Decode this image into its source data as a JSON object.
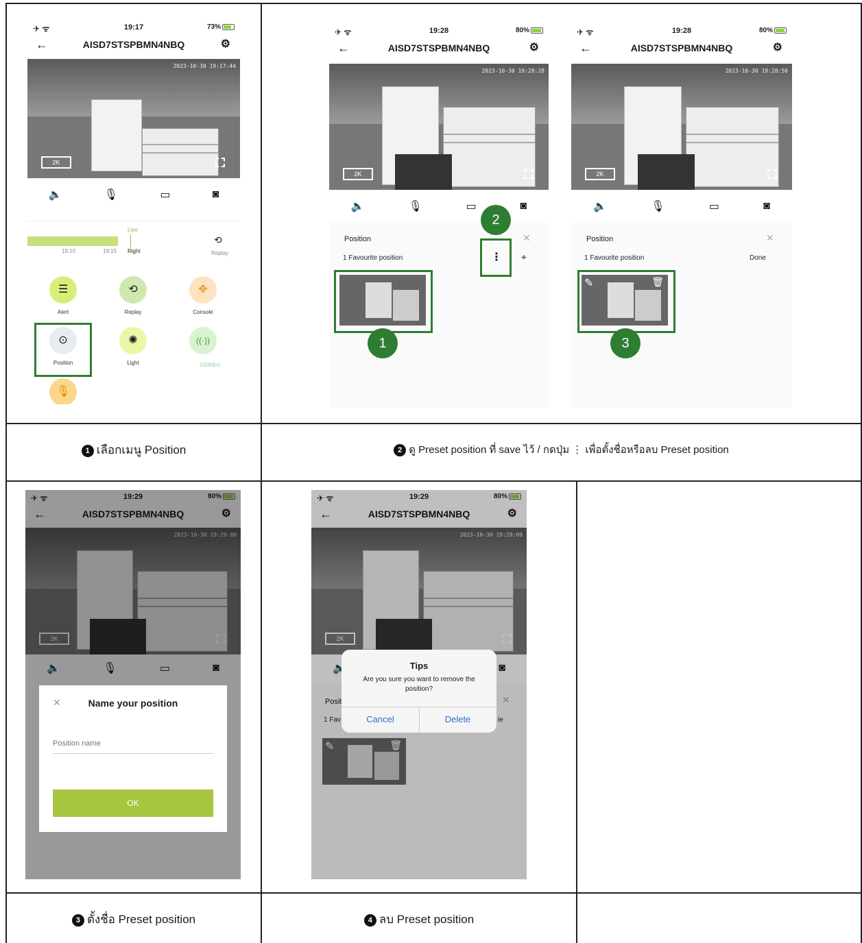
{
  "phone": {
    "device_name": "AISD7STSPBMN4NBQ",
    "quality": "2K"
  },
  "screen1": {
    "time": "19:17",
    "battery": "73%",
    "timestamp": "2023-10-30 19:17:44",
    "timeline": {
      "live": "Live",
      "t1": "19:10",
      "t2": "19:15",
      "right": "Right",
      "replay": "Replay"
    },
    "features": [
      {
        "label": "Alert"
      },
      {
        "label": "Replay"
      },
      {
        "label": "Console"
      },
      {
        "label": "Position"
      },
      {
        "label": "Light"
      },
      {
        "label": "100KB/s"
      }
    ]
  },
  "screen2": {
    "time": "19:28",
    "battery": "80%",
    "timestamp": "2023-10-30 19:28:28",
    "sheet_title": "Position",
    "favourite": "1 Favourite position"
  },
  "screen3": {
    "time": "19:28",
    "battery": "80%",
    "timestamp": "2023-10-30 19:28:50",
    "sheet_title": "Position",
    "favourite": "1 Favourite position",
    "done": "Done"
  },
  "screen4": {
    "time": "19:29",
    "battery": "80%",
    "timestamp": "2023-10-30 19:29:00",
    "dialog_title": "Name your position",
    "placeholder": "Position name",
    "ok": "OK"
  },
  "screen5": {
    "time": "19:29",
    "battery": "80%",
    "timestamp": "2023-10-30 19:29:09",
    "tips_title": "Tips",
    "tips_text": "Are you sure you want to remove the position?",
    "cancel": "Cancel",
    "delete": "Delete",
    "posit": "Posit",
    "fav": "1 Fav",
    "ie": "ie"
  },
  "markers": {
    "m1": "1",
    "m2": "2",
    "m3": "3"
  },
  "captions": {
    "c1_num": "1",
    "c1": "เลือกเมนู Position",
    "c2_num": "2",
    "c2": "ดู Preset position ที่ save ไว้ / กดปุ่ม ⋮ เพื่อตั้งชื่อหรือลบ Preset position",
    "c3_num": "3",
    "c3": "ตั้งชื่อ Preset position",
    "c4_num": "4",
    "c4": "ลบ Preset position"
  }
}
